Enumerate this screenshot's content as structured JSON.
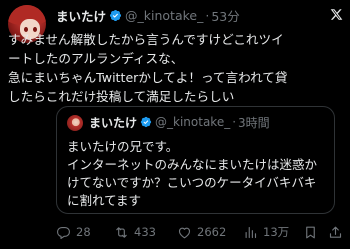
{
  "tweet": {
    "author_name": "まいたけ",
    "handle": "@_kinotake_",
    "separator": "·",
    "time": "53分",
    "text_lines": [
      "すみません解散したから言うんですけどこれツイ",
      "ートしたのアルランディスな、",
      "急にまいちゃんTwitterかしてよ！って言われて貸",
      "したらこれだけ投稿して満足したらしい"
    ],
    "platform_icon": "x-logo-icon",
    "verified_icon": "verified-badge-icon",
    "colors": {
      "background": "#000000",
      "text": "#e7e9ea",
      "secondary": "#71767b",
      "verified": "#1d9bf0",
      "border": "#2f3336"
    }
  },
  "quote": {
    "author_name": "まいたけ",
    "handle": "@_kinotake_",
    "separator": "·",
    "time": "3時間",
    "text_lines": [
      "まいたけの兄です。",
      "インターネットのみんなにまいたけは迷惑か",
      "けてないですか？こいつのケータイバキバキ",
      "に割れてます"
    ]
  },
  "actions": {
    "replies": {
      "icon": "reply-icon",
      "count": "28"
    },
    "retweets": {
      "icon": "retweet-icon",
      "count": "433"
    },
    "likes": {
      "icon": "heart-icon",
      "count": "2662"
    },
    "views": {
      "icon": "views-chart-icon",
      "count": "13万"
    },
    "bookmark": {
      "icon": "bookmark-icon"
    },
    "share": {
      "icon": "share-icon"
    }
  }
}
